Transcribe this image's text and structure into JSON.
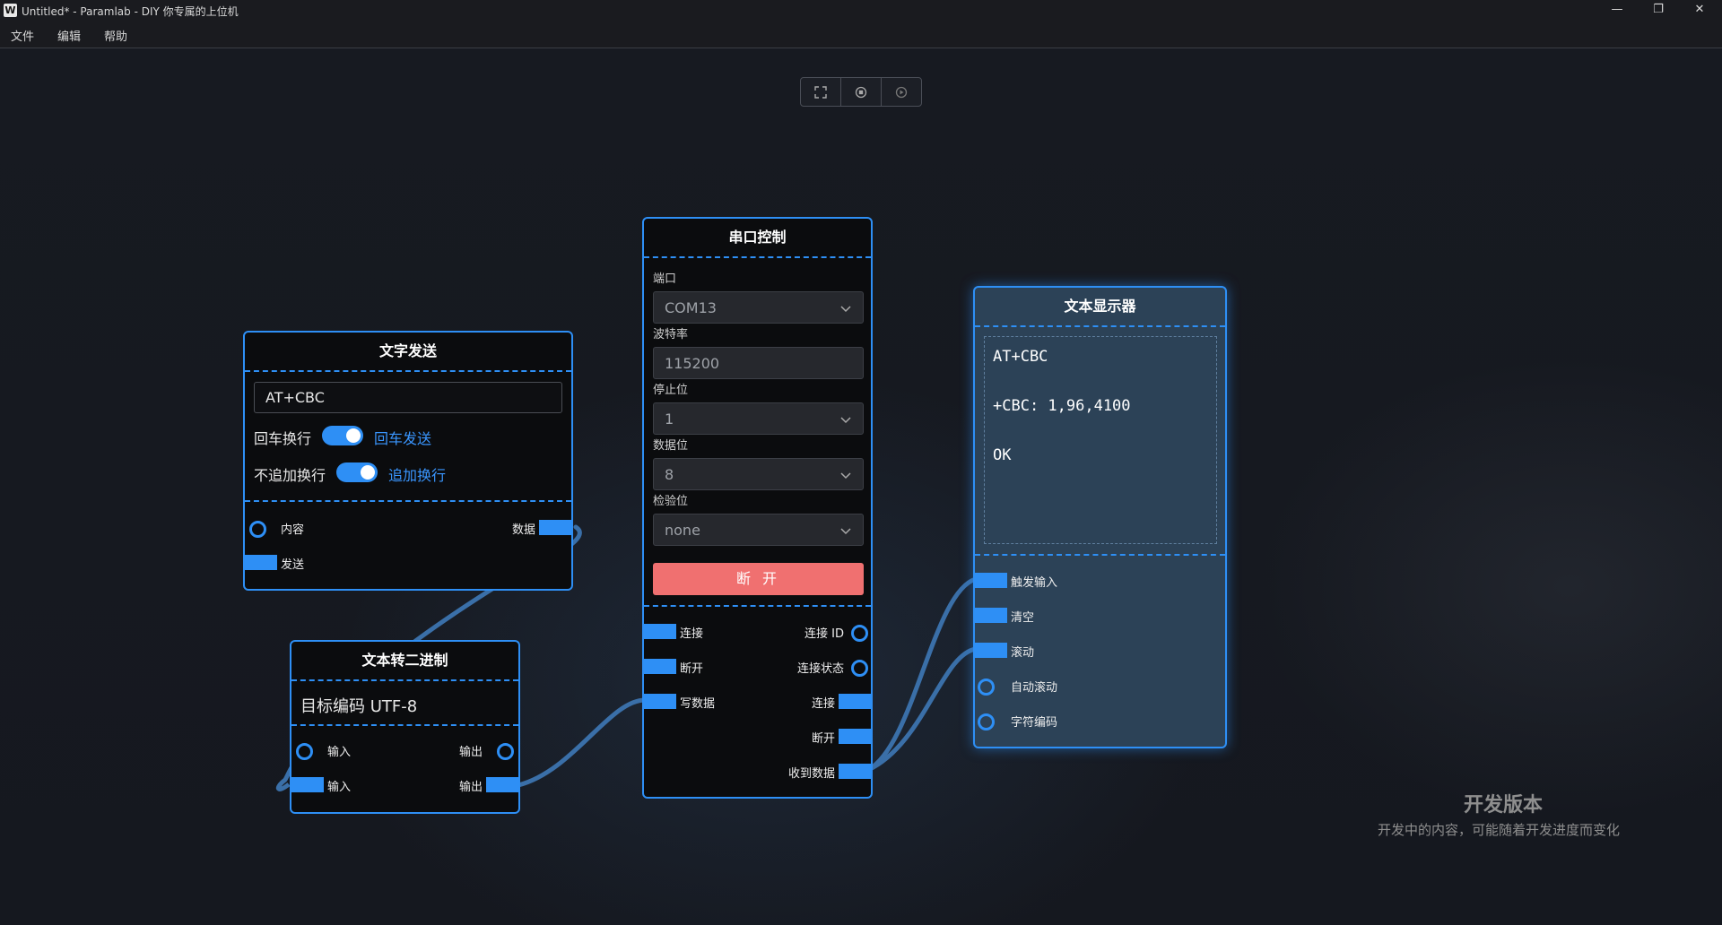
{
  "window": {
    "title": "Untitled* - Paramlab - DIY 你专属的上位机",
    "logo_letter": "W",
    "minimize": "—",
    "restore": "❐",
    "close": "✕"
  },
  "menu": [
    "文件",
    "编辑",
    "帮助"
  ],
  "toolbar": {
    "icons": [
      "fullscreen-icon",
      "stop-icon",
      "play-icon"
    ]
  },
  "text_send_node": {
    "title": "文字发送",
    "input_value": "AT+CBC",
    "enter_newline_label": "回车换行",
    "enter_newline_on": true,
    "enter_send_label": "回车发送",
    "append_newline_label": "不追加换行",
    "append_newline_on": true,
    "append_newline_link": "追加换行",
    "ports": {
      "content": "内容",
      "data": "数据",
      "send": "发送"
    }
  },
  "text_to_binary_node": {
    "title": "文本转二进制",
    "encoding_label": "目标编码 UTF-8",
    "ports": {
      "input1": "输入",
      "output1": "输出",
      "input2": "输入",
      "output2": "输出"
    }
  },
  "serial_node": {
    "title": "串口控制",
    "port_label": "端口",
    "port_value": "COM13",
    "baud_label": "波特率",
    "baud_value": "115200",
    "stopbits_label": "停止位",
    "stopbits_value": "1",
    "databits_label": "数据位",
    "databits_value": "8",
    "parity_label": "检验位",
    "parity_value": "none",
    "disconnect_button": "断 开",
    "ports": {
      "connect": "连接",
      "connect_id": "连接 ID",
      "disconnect": "断开",
      "connect_status": "连接状态",
      "write_data": "写数据",
      "connect_out": "连接",
      "disconnect_out": "断开",
      "received_data": "收到数据"
    }
  },
  "display_node": {
    "title": "文本显示器",
    "lines": [
      "AT+CBC",
      "+CBC: 1,96,4100",
      "OK"
    ],
    "ports": {
      "trigger_input": "触发输入",
      "clear": "清空",
      "scroll": "滚动",
      "auto_scroll": "自动滚动",
      "char_encoding": "字符编码"
    }
  },
  "watermark": {
    "title": "开发版本",
    "subtitle": "开发中的内容，可能随着开发进度而变化"
  },
  "colors": {
    "accent": "#2e8ff5",
    "wire": "#3a6fa8",
    "danger_button": "#f07070",
    "display_bg": "#2c4257"
  }
}
